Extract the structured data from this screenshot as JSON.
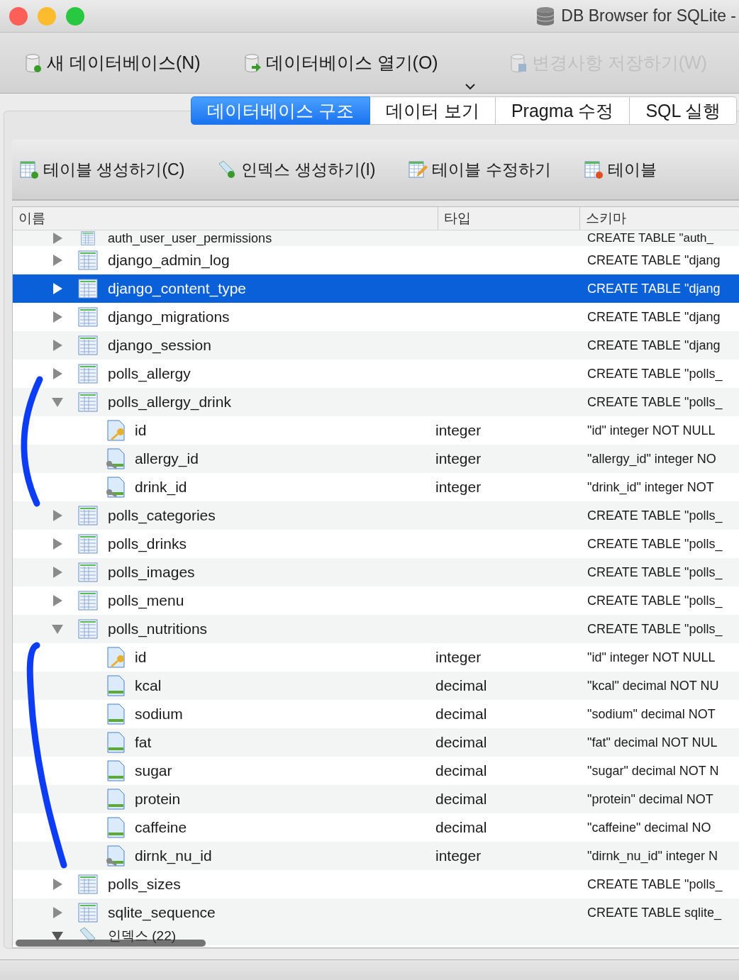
{
  "window": {
    "title": "DB Browser for SQLite -"
  },
  "toolbar": [
    {
      "label": "새 데이터베이스(N)",
      "kind": "new",
      "disabled": false
    },
    {
      "label": "데이터베이스 열기(O)",
      "kind": "open",
      "disabled": false
    },
    {
      "label": "변경사항 저장하기(W)",
      "kind": "save",
      "disabled": true
    }
  ],
  "tabs": [
    {
      "label": "데이터베이스 구조",
      "selected": true
    },
    {
      "label": "데이터 보기",
      "selected": false
    },
    {
      "label": "Pragma 수정",
      "selected": false
    },
    {
      "label": "SQL 실행",
      "selected": false
    }
  ],
  "actions": [
    {
      "label": "테이블 생성하기(C)",
      "kind": "create-table"
    },
    {
      "label": "인덱스 생성하기(I)",
      "kind": "create-index"
    },
    {
      "label": "테이블 수정하기",
      "kind": "edit-table"
    },
    {
      "label": "테이블",
      "kind": "delete-table"
    }
  ],
  "tree": {
    "columns": [
      "이름",
      "타입",
      "스키마"
    ],
    "tables": [
      {
        "name": "auth_user_user_permissions",
        "schema": "CREATE TABLE \"auth_",
        "expanded": false,
        "selected": false
      },
      {
        "name": "django_admin_log",
        "schema": "CREATE TABLE \"djang",
        "expanded": false,
        "selected": false
      },
      {
        "name": "django_content_type",
        "schema": "CREATE TABLE \"djang",
        "expanded": false,
        "selected": true
      },
      {
        "name": "django_migrations",
        "schema": "CREATE TABLE \"djang",
        "expanded": false,
        "selected": false
      },
      {
        "name": "django_session",
        "schema": "CREATE TABLE \"djang",
        "expanded": false,
        "selected": false
      },
      {
        "name": "polls_allergy",
        "schema": "CREATE TABLE \"polls_",
        "expanded": false,
        "selected": false
      },
      {
        "name": "polls_allergy_drink",
        "schema": "CREATE TABLE \"polls_",
        "expanded": true,
        "selected": false,
        "children": [
          {
            "name": "id",
            "type": "integer",
            "schema": "\"id\" integer NOT NULL",
            "kind": "primary"
          },
          {
            "name": "allergy_id",
            "type": "integer",
            "schema": "\"allergy_id\" integer NO",
            "kind": "foreign"
          },
          {
            "name": "drink_id",
            "type": "integer",
            "schema": "\"drink_id\" integer NOT",
            "kind": "foreign"
          }
        ]
      },
      {
        "name": "polls_categories",
        "schema": "CREATE TABLE \"polls_",
        "expanded": false,
        "selected": false
      },
      {
        "name": "polls_drinks",
        "schema": "CREATE TABLE \"polls_",
        "expanded": false,
        "selected": false
      },
      {
        "name": "polls_images",
        "schema": "CREATE TABLE \"polls_",
        "expanded": false,
        "selected": false
      },
      {
        "name": "polls_menu",
        "schema": "CREATE TABLE \"polls_",
        "expanded": false,
        "selected": false
      },
      {
        "name": "polls_nutritions",
        "schema": "CREATE TABLE \"polls_",
        "expanded": true,
        "selected": false,
        "children": [
          {
            "name": "id",
            "type": "integer",
            "schema": "\"id\" integer NOT NULL",
            "kind": "primary"
          },
          {
            "name": "kcal",
            "type": "decimal",
            "schema": "\"kcal\" decimal NOT NU",
            "kind": "plain"
          },
          {
            "name": "sodium",
            "type": "decimal",
            "schema": "\"sodium\" decimal NOT",
            "kind": "plain"
          },
          {
            "name": "fat",
            "type": "decimal",
            "schema": "\"fat\" decimal NOT NUL",
            "kind": "plain"
          },
          {
            "name": "sugar",
            "type": "decimal",
            "schema": "\"sugar\" decimal NOT N",
            "kind": "plain"
          },
          {
            "name": "protein",
            "type": "decimal",
            "schema": "\"protein\" decimal NOT",
            "kind": "plain"
          },
          {
            "name": "caffeine",
            "type": "decimal",
            "schema": "\"caffeine\" decimal NO",
            "kind": "plain"
          },
          {
            "name": "dirnk_nu_id",
            "type": "integer",
            "schema": "\"dirnk_nu_id\" integer N",
            "kind": "foreign"
          }
        ]
      },
      {
        "name": "polls_sizes",
        "schema": "CREATE TABLE \"polls_",
        "expanded": false,
        "selected": false
      },
      {
        "name": "sqlite_sequence",
        "schema": "CREATE TABLE sqlite_",
        "expanded": false,
        "selected": false
      }
    ],
    "indexes": {
      "label": "인덱스 (22)",
      "expanded": true
    }
  }
}
